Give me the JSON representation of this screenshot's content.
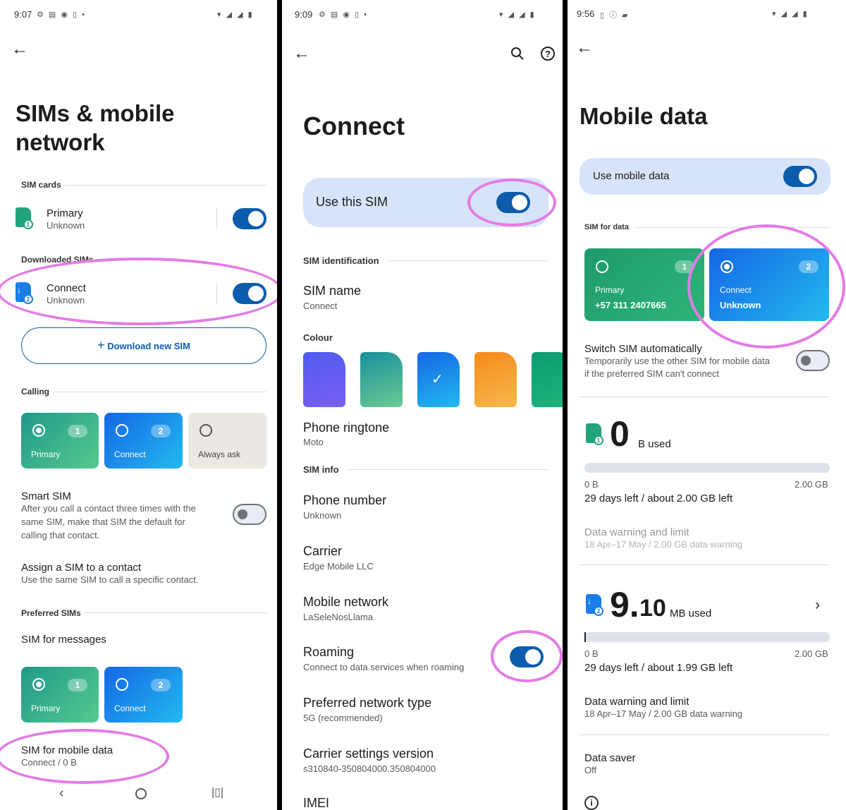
{
  "colors": {
    "accent": "#0b5cad",
    "highlight": "#e47be6",
    "sim1": "#21a37e",
    "sim2": "#1a7ee8",
    "swatch_purple": "#5b5ff0",
    "swatch_teal": "#2aa69a",
    "swatch_blue": "#1a7ee8",
    "swatch_orange": "#f5a623",
    "swatch_green": "#0fa070"
  },
  "p1": {
    "status_time": "9:07",
    "title_line1": "SIMs & mobile",
    "title_line2": "network",
    "sim_cards_label": "SIM cards",
    "primary_name": "Primary",
    "primary_status": "Unknown",
    "primary_badge": "1",
    "downloaded_label": "Downloaded SIMs",
    "connect_name": "Connect",
    "connect_status": "Unknown",
    "connect_badge": "2",
    "download_button": "Download new SIM",
    "calling_label": "Calling",
    "calling_cards": [
      {
        "label": "Primary",
        "num": "1"
      },
      {
        "label": "Connect",
        "num": "2"
      },
      {
        "label": "Always ask"
      }
    ],
    "smart_sim_title": "Smart SIM",
    "smart_sim_desc_1": "After you call a contact three times with the",
    "smart_sim_desc_2": "same SIM, make that SIM the default for",
    "smart_sim_desc_3": "calling that contact.",
    "assign_title": "Assign a SIM to a contact",
    "assign_desc": "Use the same SIM to call a specific contact.",
    "preferred_label": "Preferred SIMs",
    "sim_messages": "SIM for messages",
    "message_cards": [
      {
        "label": "Primary",
        "num": "1"
      },
      {
        "label": "Connect",
        "num": "2"
      }
    ],
    "sim_mobile_data_title": "SIM for mobile data",
    "sim_mobile_data_value": "Connect / 0 B"
  },
  "p2": {
    "status_time": "9:09",
    "title": "Connect",
    "use_sim": "Use this SIM",
    "sim_identification": "SIM identification",
    "sim_name_title": "SIM name",
    "sim_name_value": "Connect",
    "colour_label": "Colour",
    "ringtone_title": "Phone ringtone",
    "ringtone_value": "Moto",
    "sim_info_label": "SIM info",
    "phone_number_title": "Phone number",
    "phone_number_value": "Unknown",
    "carrier_title": "Carrier",
    "carrier_value": "Edge Mobile LLC",
    "mobile_network_title": "Mobile network",
    "mobile_network_value": "LaSeleNosLlama",
    "roaming_title": "Roaming",
    "roaming_desc": "Connect to data services when roaming",
    "network_type_title": "Preferred network type",
    "network_type_value": "5G (recommended)",
    "carrier_settings_title": "Carrier settings version",
    "carrier_settings_value": "s310840-350804000.350804000",
    "imei_title": "IMEI"
  },
  "p3": {
    "status_time": "9:56",
    "title": "Mobile data",
    "use_mobile_data": "Use mobile data",
    "sim_for_data_label": "SIM for data",
    "card1_label": "Primary",
    "card1_number": "+57 311 2407665",
    "card1_num": "1",
    "card2_label": "Connect",
    "card2_number": "Unknown",
    "card2_num": "2",
    "switch_title": "Switch SIM automatically",
    "switch_desc_1": "Temporarily use the other SIM for mobile data",
    "switch_desc_2": "if the preferred SIM can't connect",
    "usage1_big": "0",
    "usage1_unit": "B used",
    "usage1_fraction": 0,
    "usage1_min": "0 B",
    "usage1_max": "2.00 GB",
    "usage1_left": "29 days left / about 2.00 GB left",
    "warn1_title": "Data warning and limit",
    "warn1_desc": "18 Apr–17 May / 2.00 GB data warning",
    "usage2_big": "9.",
    "usage2_big2": "10",
    "usage2_unit": "MB used",
    "usage2_fraction": 0.005,
    "usage2_min": "0 B",
    "usage2_max": "2.00 GB",
    "usage2_left": "29 days left / about 1.99 GB left",
    "warn2_title": "Data warning and limit",
    "warn2_desc": "18 Apr–17 May / 2.00 GB data warning",
    "saver_title": "Data saver",
    "saver_value": "Off"
  }
}
